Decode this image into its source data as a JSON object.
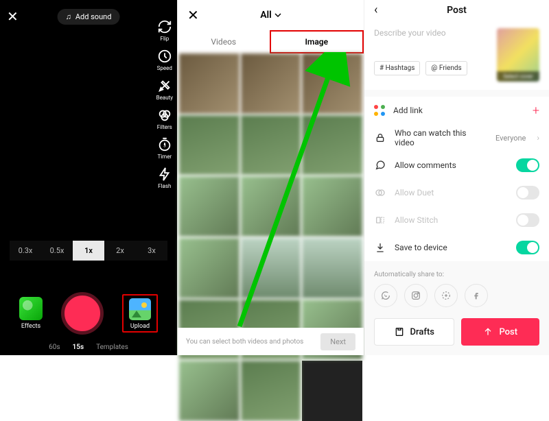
{
  "camera": {
    "add_sound_label": "Add sound",
    "tools": {
      "flip": "Flip",
      "speed": "Speed",
      "beauty": "Beauty",
      "filters": "Filters",
      "timer": "Timer",
      "flash": "Flash"
    },
    "speeds": [
      "0.3x",
      "0.5x",
      "1x",
      "2x",
      "3x"
    ],
    "active_speed": "1x",
    "effects_label": "Effects",
    "upload_label": "Upload",
    "modes": [
      "60s",
      "15s",
      "Templates"
    ],
    "active_mode": "15s"
  },
  "gallery": {
    "title": "All",
    "tabs": {
      "videos": "Videos",
      "image": "Image"
    },
    "active_tab": "Image",
    "hint": "You can select both videos and photos",
    "next_label": "Next"
  },
  "post": {
    "title": "Post",
    "describe_placeholder": "Describe your video",
    "cover_label": "Select cover",
    "chips": {
      "hashtags": "# Hashtags",
      "friends": "@ Friends"
    },
    "rows": {
      "add_link": "Add link",
      "privacy_label": "Who can watch this video",
      "privacy_value": "Everyone",
      "allow_comments": "Allow comments",
      "allow_duet": "Allow Duet",
      "allow_stitch": "Allow Stitch",
      "save_device": "Save to device"
    },
    "toggles": {
      "comments": true,
      "duet": false,
      "stitch": false,
      "save": true
    },
    "share_label": "Automatically share to:",
    "drafts_label": "Drafts",
    "post_label": "Post"
  }
}
